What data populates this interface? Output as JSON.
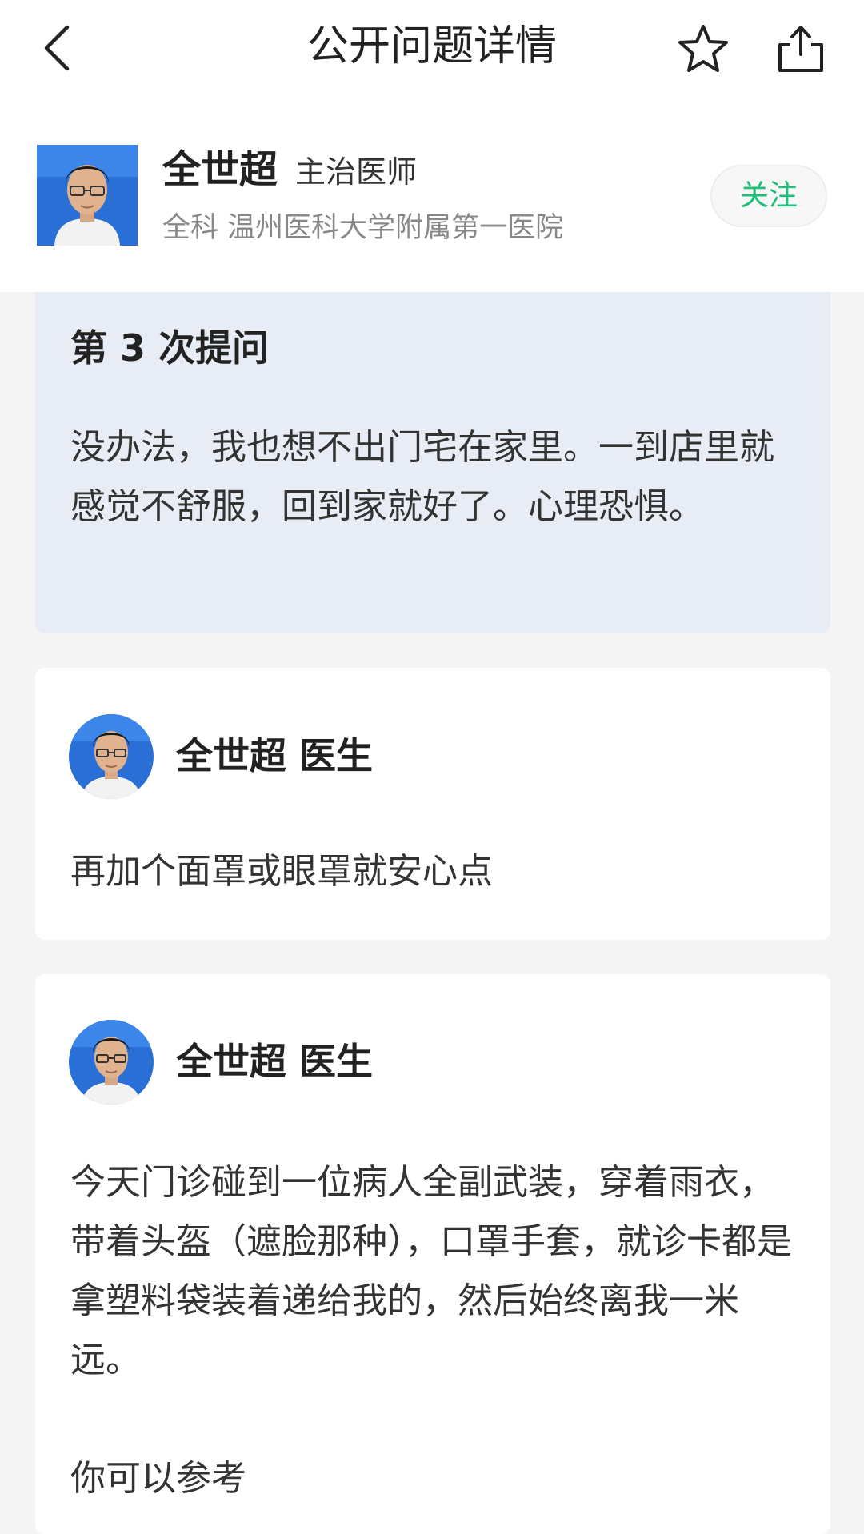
{
  "nav": {
    "title": "公开问题详情",
    "back_icon": "chevron-left-icon",
    "favorite_icon": "star-icon",
    "share_icon": "share-icon"
  },
  "doctor": {
    "name": "全世超",
    "title": "主治医师",
    "department": "全科 温州医科大学附属第一医院",
    "follow_label": "关注"
  },
  "question": {
    "heading": "第 3 次提问",
    "body": "没办法，我也想不出门宅在家里。一到店里就感觉不舒服，回到家就好了。心理恐惧。"
  },
  "answers": [
    {
      "author": "全世超 医生",
      "text": "再加个面罩或眼罩就安心点"
    },
    {
      "author": "全世超 医生",
      "paragraph1": "今天门诊碰到一位病人全副武装，穿着雨衣，带着头盔（遮脸那种），口罩手套，就诊卡都是拿塑料袋装着递给我的，然后始终离我一米远。",
      "paragraph2": "你可以参考"
    }
  ],
  "colors": {
    "accent_green": "#1fbf7a",
    "question_bg": "#e8ecf4",
    "page_bg": "#f4f4f4",
    "photo_blue": "#2a6fd6"
  }
}
